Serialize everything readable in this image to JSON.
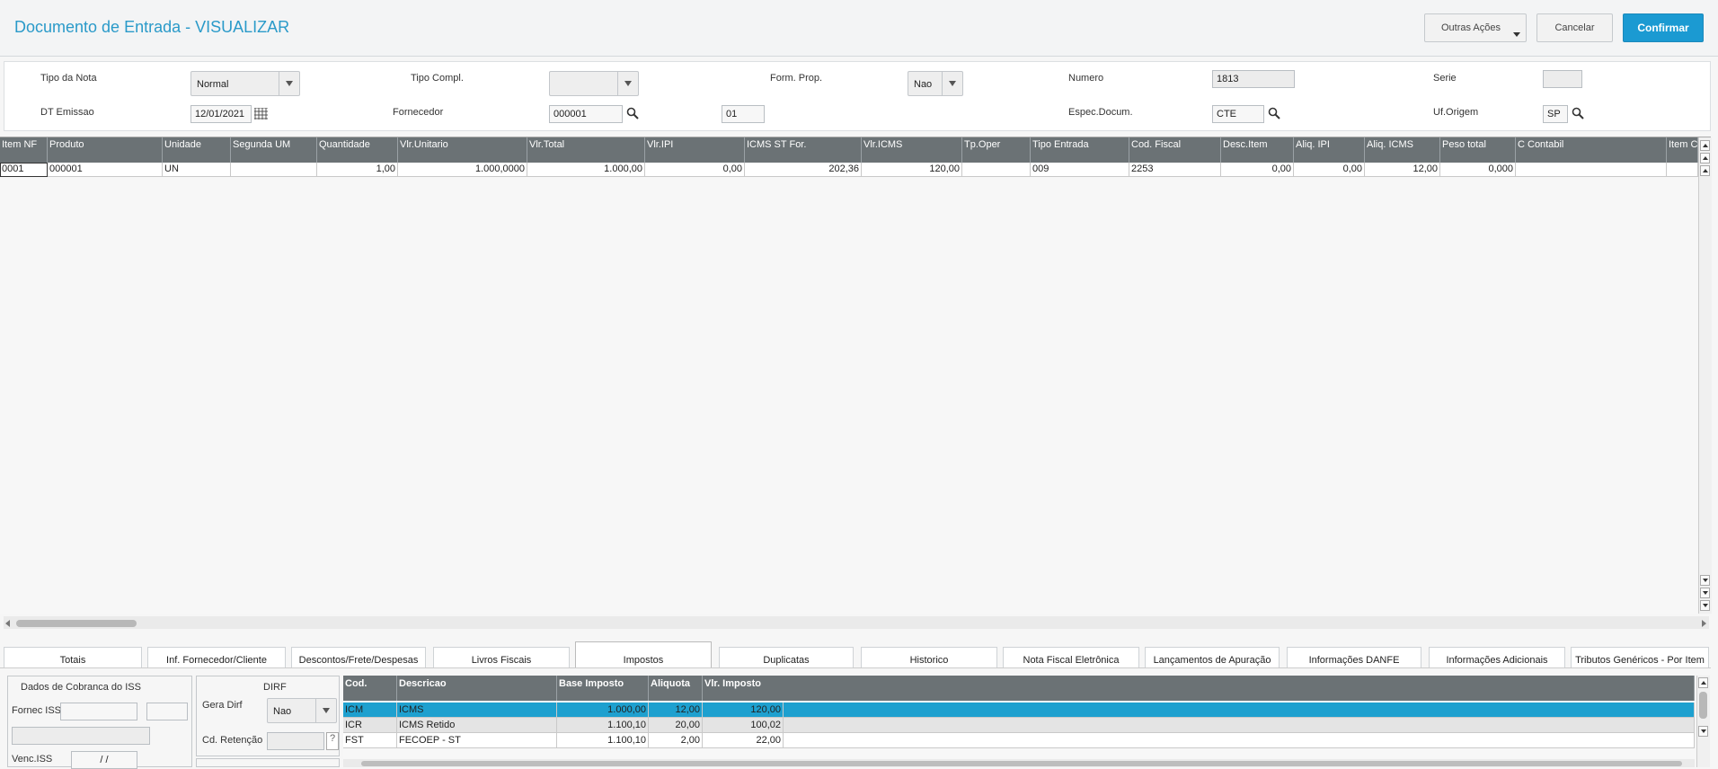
{
  "header": {
    "title": "Documento de Entrada - VISUALIZAR",
    "buttons": {
      "outras": "Outras Ações",
      "cancelar": "Cancelar",
      "confirmar": "Confirmar"
    }
  },
  "form": {
    "tipo_nota_label": "Tipo da Nota",
    "tipo_nota_value": "Normal",
    "tipo_compl_label": "Tipo Compl.",
    "tipo_compl_value": "",
    "form_prop_label": "Form. Prop.",
    "form_prop_value": "Nao",
    "numero_label": "Numero",
    "numero_value": "1813",
    "serie_label": "Serie",
    "serie_value": "",
    "dt_emissao_label": "DT Emissao",
    "dt_emissao_value": "12/01/2021",
    "fornecedor_label": "Fornecedor",
    "fornecedor_value": "000001",
    "loja_value": "01",
    "espec_label": "Espec.Docum.",
    "espec_value": "CTE",
    "uf_label": "Uf.Origem",
    "uf_value": "SP"
  },
  "grid": {
    "headers": [
      "Item NF",
      "Produto",
      "Unidade",
      "Segunda UM",
      "Quantidade",
      "Vlr.Unitario",
      "Vlr.Total",
      "Vlr.IPI",
      "ICMS ST For.",
      "Vlr.ICMS",
      "Tp.Oper",
      "Tipo Entrada",
      "Cod. Fiscal",
      "Desc.Item",
      "Aliq. IPI",
      "Aliq. ICMS",
      "Peso total",
      "C Contabil",
      "Item Co"
    ],
    "row": [
      "0001",
      "000001",
      "UN",
      "",
      "1,00",
      "1.000,0000",
      "1.000,00",
      "0,00",
      "202,36",
      "120,00",
      "",
      "009",
      "2253",
      "0,00",
      "0,00",
      "12,00",
      "0,000",
      "",
      ""
    ]
  },
  "tabs": [
    "Totais",
    "Inf. Fornecedor/Cliente",
    "Descontos/Frete/Despesas",
    "Livros Fiscais",
    "Impostos",
    "Duplicatas",
    "Historico",
    "Nota Fiscal Eletrônica",
    "Lançamentos de Apuração",
    "Informações DANFE",
    "Informações Adicionais",
    "Tributos Genéricos - Por Item"
  ],
  "iss": {
    "title": "Dados de Cobranca do ISS",
    "fornec_label": "Fornec ISS",
    "venc_label": "Venc.ISS",
    "venc_value": " /  /"
  },
  "dirf": {
    "title": "DIRF",
    "gera_label": "Gera Dirf",
    "gera_value": "Nao",
    "cd_ret_label": "Cd. Retenção",
    "help": "?"
  },
  "taxes": {
    "headers": [
      "Cod.",
      "Descricao",
      "Base Imposto",
      "Aliquota",
      "Vlr. Imposto"
    ],
    "rows": [
      [
        "ICM",
        "ICMS",
        "1.000,00",
        "12,00",
        "120,00"
      ],
      [
        "ICR",
        "ICMS Retido",
        "1.100,10",
        "20,00",
        "100,02"
      ],
      [
        "FST",
        "FECOEP - ST",
        "1.100,10",
        "2,00",
        "22,00"
      ]
    ]
  },
  "colors": {
    "accent": "#1b9ad2",
    "grid_header": "#6b7275",
    "selected_row": "#1ea0cf"
  }
}
